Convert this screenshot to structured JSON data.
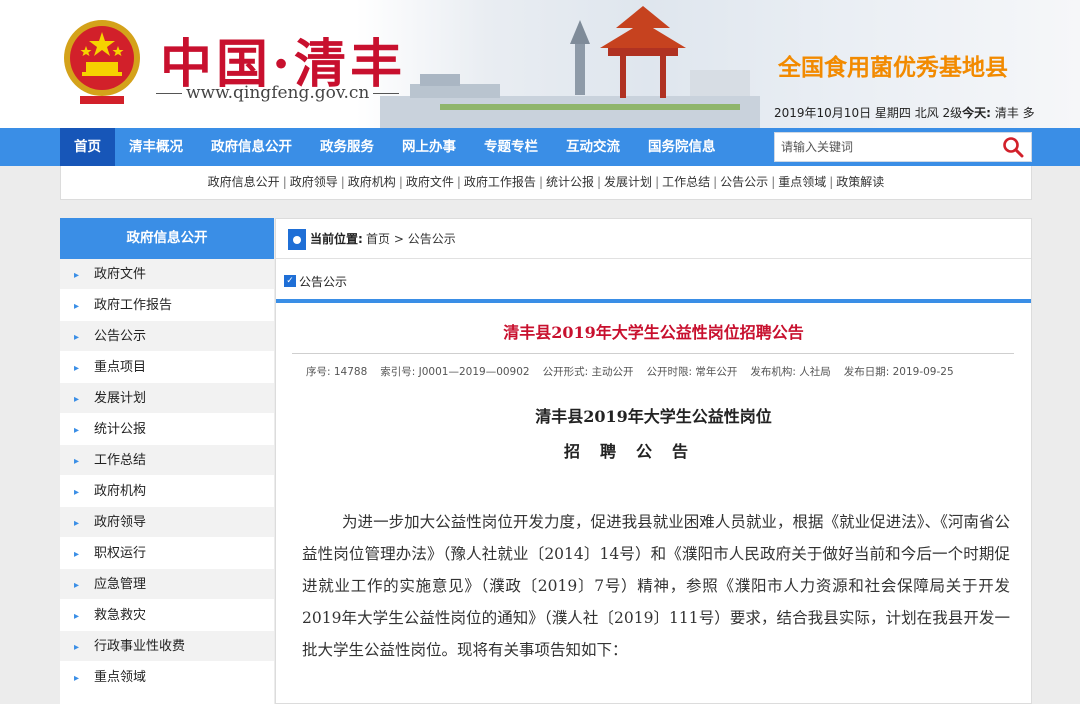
{
  "header": {
    "logo_title": "中国·清丰",
    "logo_url": "www.qingfeng.gov.cn",
    "slogan": "全国食用菌优秀基地县",
    "date_text": "2019年10月10日 星期四  北风 2级",
    "weather_label": "今天:",
    "weather_loc": "清丰 多"
  },
  "nav": {
    "items": [
      "首页",
      "清丰概况",
      "政府信息公开",
      "政务服务",
      "网上办事",
      "专题专栏",
      "互动交流",
      "国务院信息"
    ],
    "search_placeholder": "请输入关键词",
    "search_icon": "search-icon"
  },
  "sublinks": [
    "政府信息公开",
    "政府领导",
    "政府机构",
    "政府文件",
    "政府工作报告",
    "统计公报",
    "发展计划",
    "工作总结",
    "公告公示",
    "重点领域",
    "政策解读"
  ],
  "sidebar": {
    "title": "政府信息公开",
    "items": [
      "政府文件",
      "政府工作报告",
      "公告公示",
      "重点项目",
      "发展计划",
      "统计公报",
      "工作总结",
      "政府机构",
      "政府领导",
      "职权运行",
      "应急管理",
      "救急救灾",
      "行政事业性收费",
      "重点领域"
    ]
  },
  "breadcrumb": {
    "label": "当前位置:",
    "home": "首页",
    "sep": ">",
    "current": "公告公示"
  },
  "section": {
    "label": "公告公示"
  },
  "article": {
    "title": "清丰县2019年大学生公益性岗位招聘公告",
    "meta": {
      "seq": "序号: 14788",
      "index": "索引号: J0001—2019—00902",
      "form": "公开形式: 主动公开",
      "period": "公开时限: 常年公开",
      "agency": "发布机构: 人社局",
      "date": "发布日期: 2019-09-25"
    },
    "doc_title": "清丰县2019年大学生公益性岗位",
    "doc_sub": "招聘公告",
    "body": "为进一步加大公益性岗位开发力度，促进我县就业困难人员就业，根据《就业促进法》、《河南省公益性岗位管理办法》（豫人社就业〔2014〕14号）和《濮阳市人民政府关于做好当前和今后一个时期促进就业工作的实施意见》（濮政〔2019〕7号）精神，参照《濮阳市人力资源和社会保障局关于开发2019年大学生公益性岗位的通知》（濮人社〔2019〕111号）要求，结合我县实际，计划在我县开发一批大学生公益性岗位。现将有关事项告知如下："
  },
  "colors": {
    "nav_blue": "#3a8ee6",
    "nav_active": "#1756b8",
    "title_red": "#c8102e",
    "slogan_orange": "#f28a00"
  }
}
